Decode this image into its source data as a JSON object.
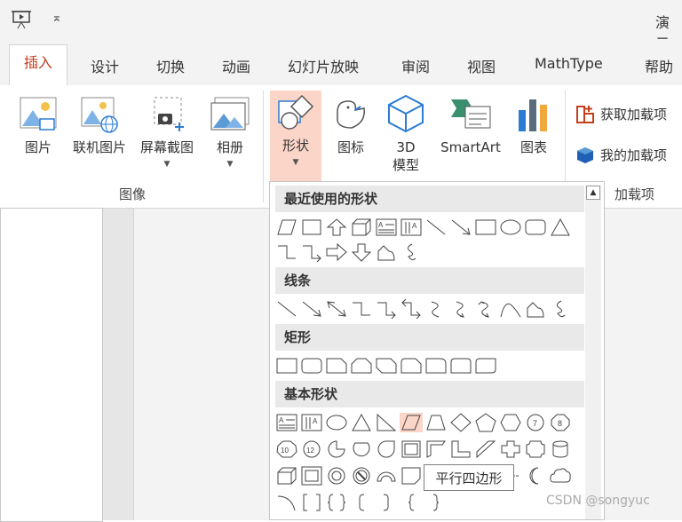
{
  "app": {
    "title_fragment": "演示",
    "qat_more": "⌅"
  },
  "tabs": [
    "插入",
    "设计",
    "切换",
    "动画",
    "幻灯片放映",
    "审阅",
    "视图",
    "MathType",
    "帮助"
  ],
  "ribbon": {
    "images_group": {
      "label": "图像",
      "buttons": [
        "图片",
        "联机图片",
        "屏幕截图",
        "相册"
      ]
    },
    "illustrations": {
      "buttons": [
        "形状",
        "图标",
        "3D\n模型",
        "SmartArt",
        "图表"
      ],
      "model_line1": "3D",
      "model_line2": "模型"
    },
    "addins_group": {
      "label": "加载项",
      "buttons": [
        "获取加载项",
        "我的加载项"
      ]
    }
  },
  "gallery": {
    "sections": [
      "最近使用的形状",
      "线条",
      "矩形",
      "基本形状"
    ],
    "tooltip": "平行四边形"
  },
  "watermark": "CSDN @songyuc",
  "colors": {
    "accent": "#c43e1c",
    "selected_bg": "#fcd5c9",
    "icon_blue": "#2b7cd3"
  }
}
